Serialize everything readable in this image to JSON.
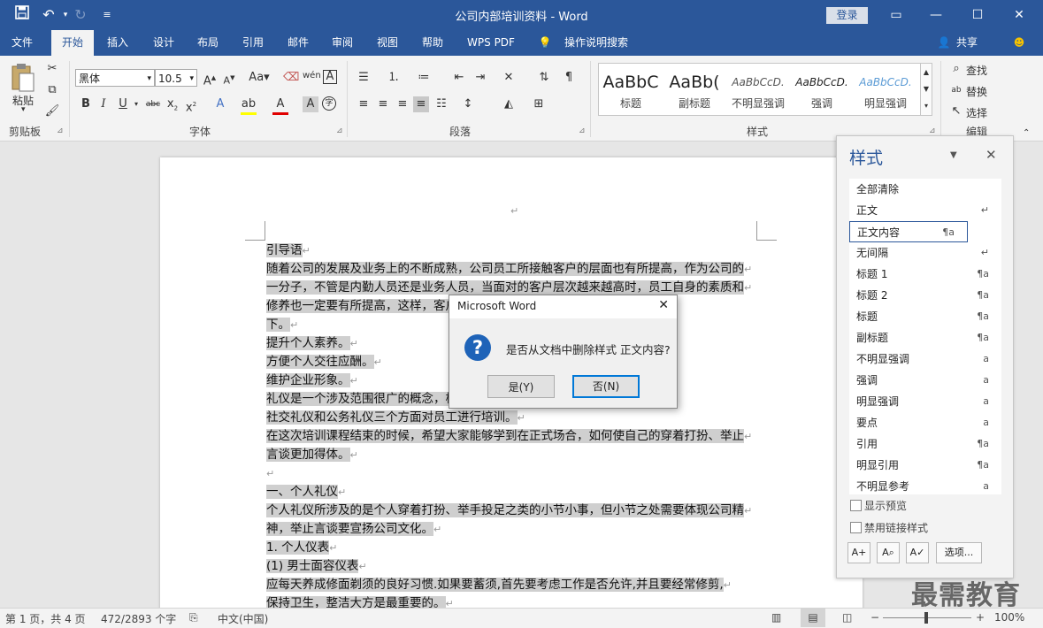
{
  "window": {
    "title": "公司内部培训资料  -  Word",
    "login": "登录"
  },
  "quick_access": [
    "save-icon",
    "undo-icon",
    "redo-icon",
    "customize-icon"
  ],
  "tabs": [
    "文件",
    "开始",
    "插入",
    "设计",
    "布局",
    "引用",
    "邮件",
    "审阅",
    "视图",
    "帮助",
    "WPS PDF",
    "操作说明搜索"
  ],
  "share_label": "共享",
  "ribbon": {
    "clipboard": {
      "paste": "粘贴",
      "label": "剪贴板"
    },
    "font": {
      "name": "黑体",
      "size": "10.5",
      "label": "字体"
    },
    "paragraph": {
      "label": "段落"
    },
    "styles": {
      "label": "样式",
      "gallery": [
        {
          "preview": "AaBbC",
          "name": "标题"
        },
        {
          "preview": "AaBb(",
          "name": "副标题"
        },
        {
          "preview": "AaBbCcD.",
          "name": "不明显强调"
        },
        {
          "preview": "AaBbCcD.",
          "name": "强调"
        },
        {
          "preview": "AaBbCcD.",
          "name": "明显强调"
        }
      ]
    },
    "editing": {
      "find": "查找",
      "replace": "替换",
      "select": "选择",
      "label": "编辑"
    }
  },
  "document": {
    "lines": [
      "引导语",
      "随着公司的发展及业务上的不断成熟，公司员工所接触客户的层面也有所提高，作为公司的",
      "一分子，不管是内勤人员还是业务人员，当面对的客户层次越来越高时，员工自身的素质和",
      "修养也一定要有所提高，这样，客户才会更满意。这次培训的最终目的如",
      "下。",
      "提升个人素养。",
      "方便个人交往应酬。",
      "维护企业形象。",
      "礼仪是一个涉及范围很广的概念，根据这次培训的目的，分为个人礼仪、",
      "社交礼仪和公务礼仪三个方面对员工进行培训。",
      "在这次培训课程结束的时候，希望大家能够学到在正式场合，如何使自己的穿着打扮、举止",
      "言谈更加得体。",
      "",
      "一、个人礼仪",
      "个人礼仪所涉及的是个人穿着打扮、举手投足之类的小节小事，但小节之处需要体现公司精",
      "神，举止言谈要宣扬公司文化。",
      "1.  个人仪表",
      "(1)  男士面容仪表",
      "应每天养成修面剃须的良好习惯.如果要蓄须,首先要考虑工作是否允许,并且要经常修剪,",
      "保持卫生，整洁大方是最重要的。"
    ],
    "line_mark": "↵"
  },
  "dialog": {
    "title": "Microsoft Word",
    "message": "是否从文档中删除样式 正文内容?",
    "yes": "是(Y)",
    "no": "否(N)"
  },
  "styles_pane": {
    "title": "样式",
    "items": [
      {
        "name": "全部清除",
        "mark": ""
      },
      {
        "name": "正文",
        "mark": "↵"
      },
      {
        "name": "正文内容",
        "mark": "¶a"
      },
      {
        "name": "无间隔",
        "mark": "↵"
      },
      {
        "name": "标题 1",
        "mark": "¶a"
      },
      {
        "name": "标题 2",
        "mark": "¶a"
      },
      {
        "name": "标题",
        "mark": "¶a"
      },
      {
        "name": "副标题",
        "mark": "¶a"
      },
      {
        "name": "不明显强调",
        "mark": "a"
      },
      {
        "name": "强调",
        "mark": "a"
      },
      {
        "name": "明显强调",
        "mark": "a"
      },
      {
        "name": "要点",
        "mark": "a"
      },
      {
        "name": "引用",
        "mark": "¶a"
      },
      {
        "name": "明显引用",
        "mark": "¶a"
      },
      {
        "name": "不明显参考",
        "mark": "a"
      }
    ],
    "selected": "正文内容",
    "show_preview": "显示预览",
    "disable_linked": "禁用链接样式",
    "options": "选项..."
  },
  "status": {
    "page": "第 1 页，共 4 页",
    "words": "472/2893 个字",
    "language": "中文(中国)",
    "zoom": "100%"
  },
  "watermark": "最需教育",
  "colors": {
    "accent": "#2b579a",
    "dialog_focus": "#0078d7",
    "highlight": "#cfcfcf"
  }
}
